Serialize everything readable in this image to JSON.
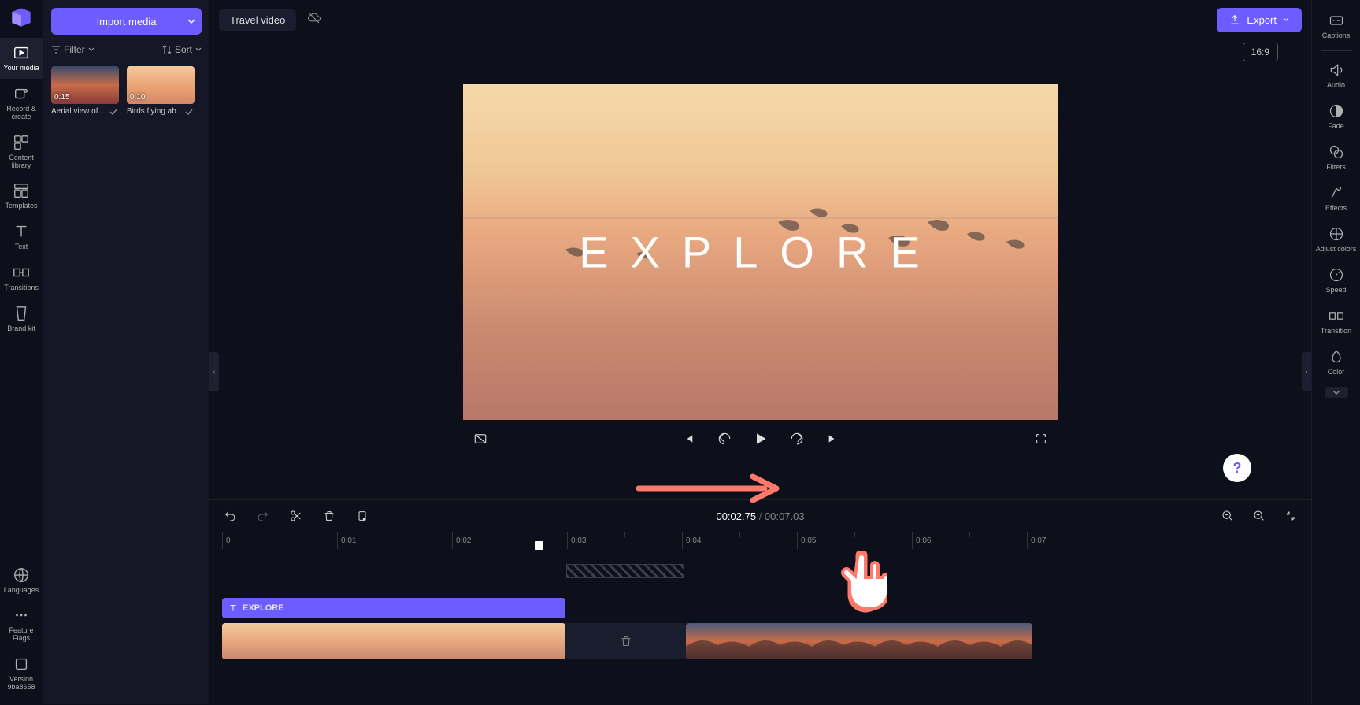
{
  "left_rail": {
    "items": [
      {
        "label": "Your media"
      },
      {
        "label": "Record & create"
      },
      {
        "label": "Content library"
      },
      {
        "label": "Templates"
      },
      {
        "label": "Text"
      },
      {
        "label": "Transitions"
      },
      {
        "label": "Brand kit"
      }
    ],
    "bottom": [
      {
        "label": "Languages"
      },
      {
        "label": "Feature Flags"
      },
      {
        "label": "Version 9ba8658"
      }
    ]
  },
  "media_panel": {
    "import_label": "Import media",
    "filter_label": "Filter",
    "sort_label": "Sort",
    "clips": [
      {
        "duration": "0:15",
        "name": "Aerial view of ..."
      },
      {
        "duration": "0:10",
        "name": "Birds flying ab..."
      }
    ]
  },
  "top_bar": {
    "project_name": "Travel video",
    "export_label": "Export"
  },
  "preview": {
    "aspect": "16:9",
    "overlay_text": "EXPLORE"
  },
  "timeline": {
    "current": "00:02.75",
    "total": "00:07.03",
    "ruler": [
      "0",
      "0:01",
      "0:02",
      "0:03",
      "0:04",
      "0:05",
      "0:06",
      "0:07"
    ],
    "text_clip_label": "EXPLORE"
  },
  "right_rail": {
    "items": [
      {
        "label": "Captions"
      },
      {
        "label": "Audio"
      },
      {
        "label": "Fade"
      },
      {
        "label": "Filters"
      },
      {
        "label": "Effects"
      },
      {
        "label": "Adjust colors"
      },
      {
        "label": "Speed"
      },
      {
        "label": "Transition"
      },
      {
        "label": "Color"
      }
    ]
  },
  "help": "?"
}
